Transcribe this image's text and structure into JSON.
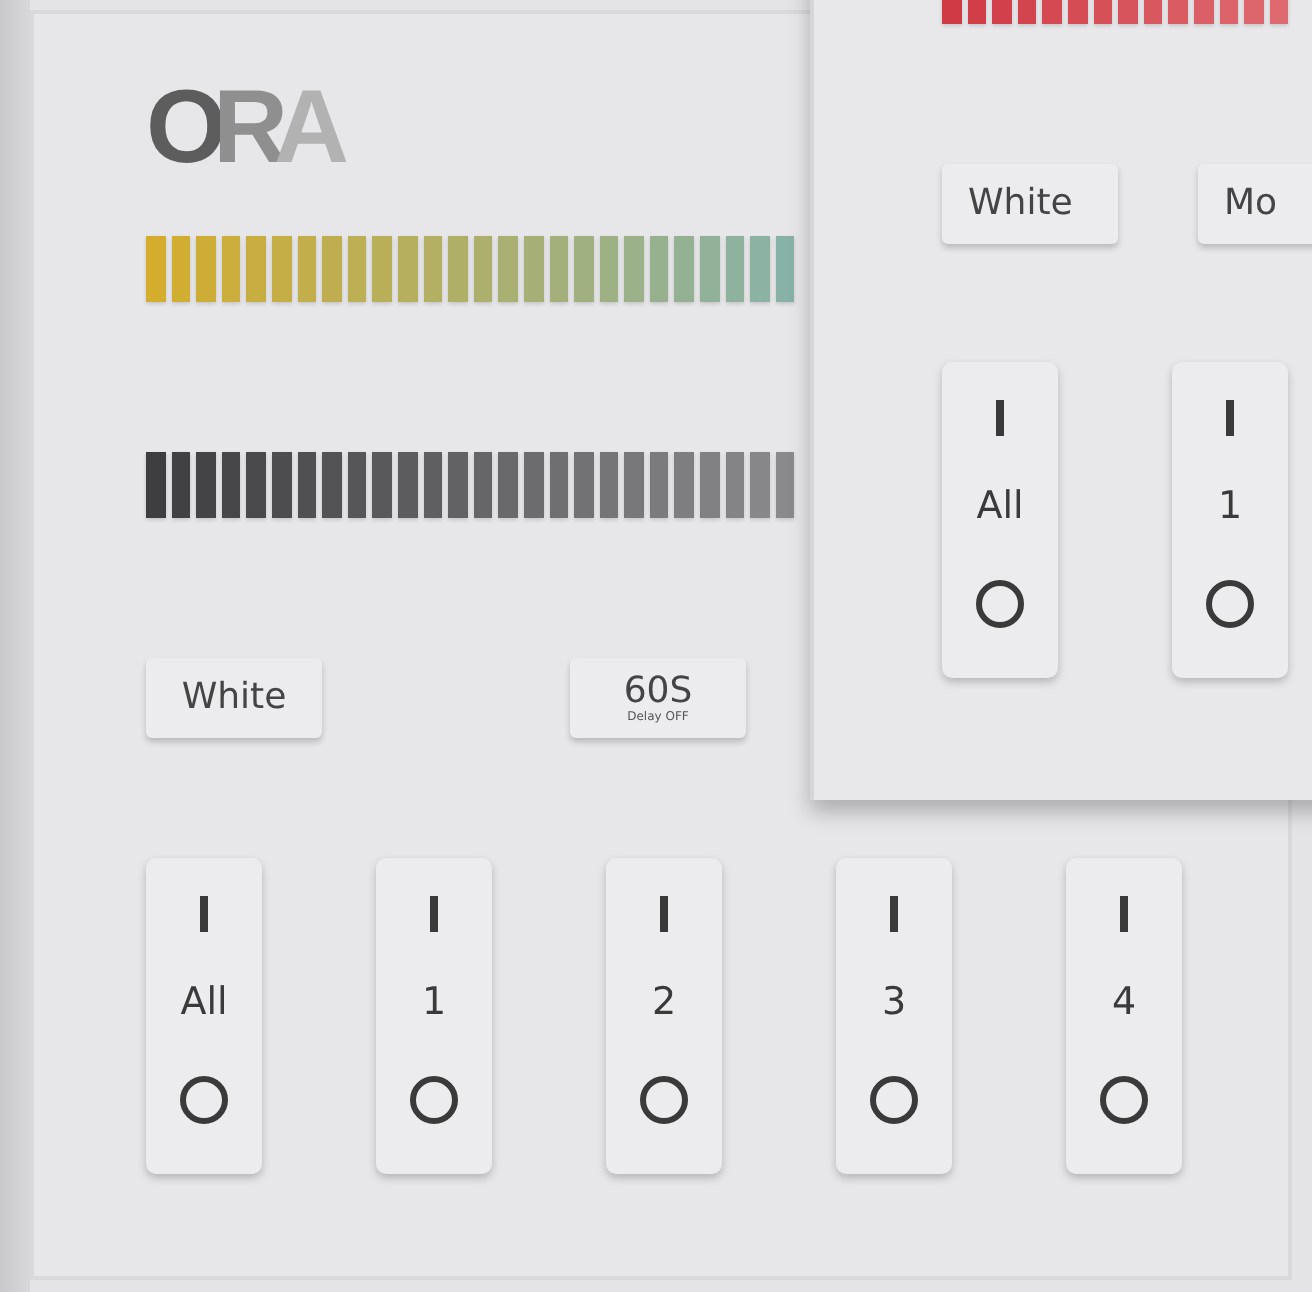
{
  "main_panel": {
    "logo": "ORA",
    "meters": [
      {
        "kind": "warm"
      },
      {
        "kind": "dark"
      }
    ],
    "buttons": [
      {
        "label": "White"
      },
      {
        "label": "60S",
        "sublabel": "Delay OFF"
      }
    ],
    "switches": [
      {
        "label": "All"
      },
      {
        "label": "1"
      },
      {
        "label": "2"
      },
      {
        "label": "3"
      },
      {
        "label": "4"
      }
    ]
  },
  "overlay_panel": {
    "meters": [
      {
        "kind": "red"
      }
    ],
    "buttons": [
      {
        "label": "White"
      },
      {
        "label": "Mo"
      }
    ],
    "switches": [
      {
        "label": "All"
      },
      {
        "label": "1"
      }
    ]
  }
}
